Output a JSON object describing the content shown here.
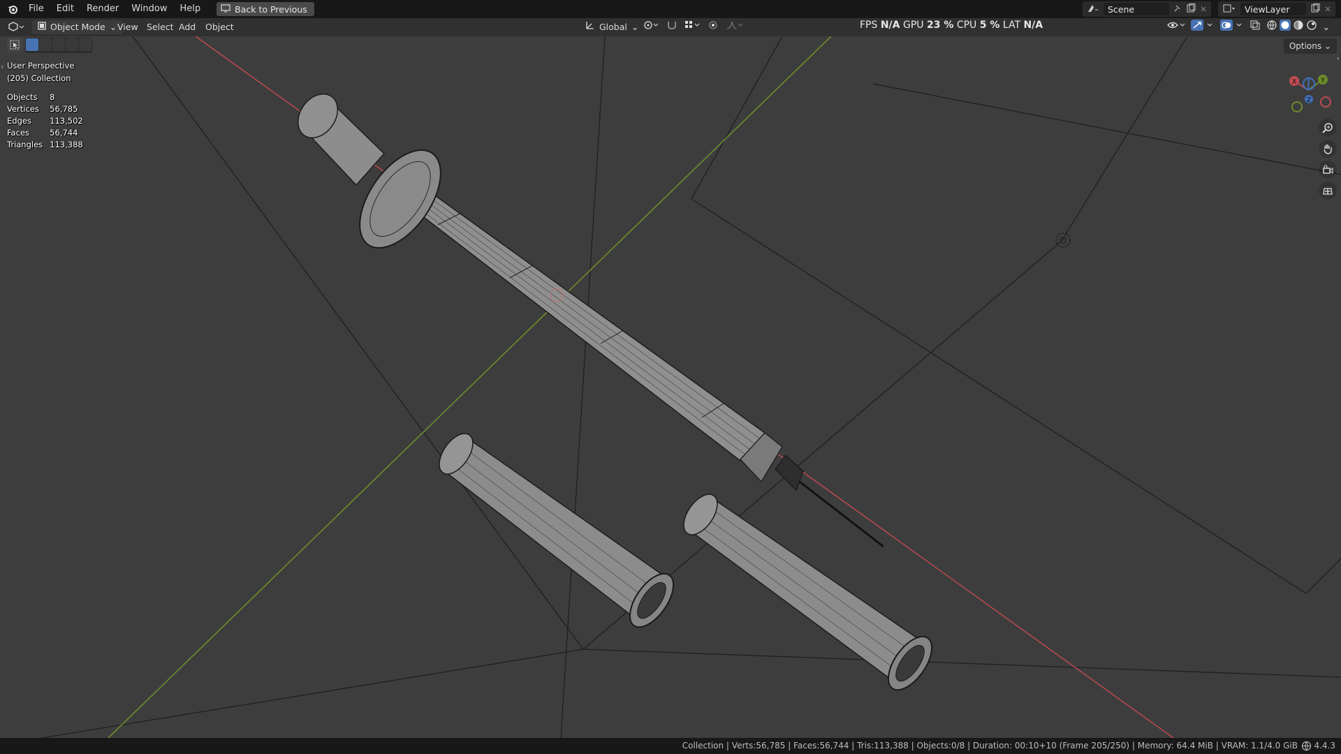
{
  "topbar": {
    "menus": [
      "File",
      "Edit",
      "Render",
      "Window",
      "Help"
    ],
    "back_button": "Back to Previous",
    "scene_name": "Scene",
    "viewlayer_name": "ViewLayer"
  },
  "header": {
    "mode": "Object Mode",
    "menus": [
      "View",
      "Select",
      "Add",
      "Object"
    ],
    "transform_orientation": "Global",
    "perf": {
      "fps_label": "FPS",
      "fps_value": "N/A",
      "gpu_label": "GPU",
      "gpu_value": "23 %",
      "cpu_label": "CPU",
      "cpu_value": "5 %",
      "lat_label": "LAT",
      "lat_value": "N/A"
    },
    "options_label": "Options"
  },
  "viewport": {
    "view_name": "User Perspective",
    "collection": "(205) Collection",
    "stats": [
      {
        "label": "Objects",
        "value": "8"
      },
      {
        "label": "Vertices",
        "value": "56,785"
      },
      {
        "label": "Edges",
        "value": "113,502"
      },
      {
        "label": "Faces",
        "value": "56,744"
      },
      {
        "label": "Triangles",
        "value": "113,388"
      }
    ],
    "gizmo": {
      "x": "X",
      "y": "Y",
      "z": "Z"
    }
  },
  "statusbar": {
    "text": "Collection | Verts:56,785 | Faces:56,744 | Tris:113,388 | Objects:0/8 | Duration: 00:10+10 (Frame 205/250) | Memory: 64.4 MiB | VRAM: 1.1/4.0 GiB",
    "version": "4.4.3"
  },
  "colors": {
    "x_axis": "#c24b52",
    "y_axis": "#6d8c2b",
    "accent": "#4772b3"
  }
}
